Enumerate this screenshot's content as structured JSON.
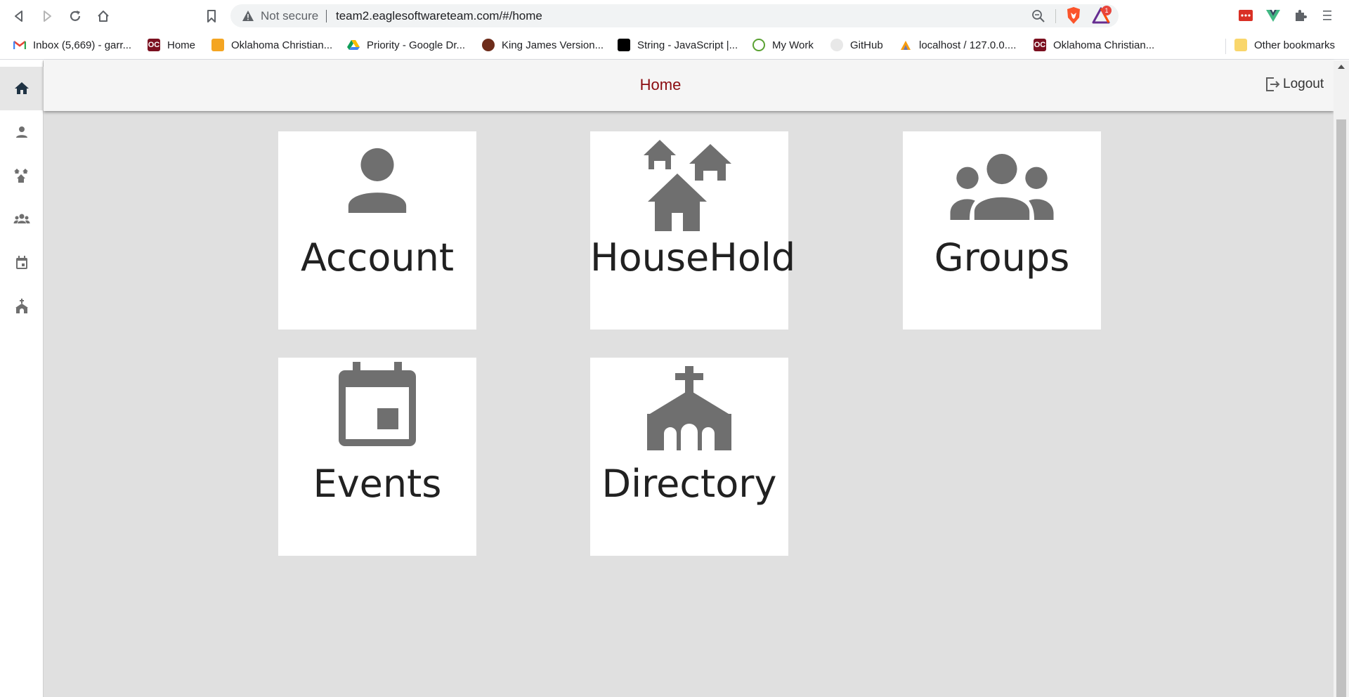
{
  "browser": {
    "security_text": "Not secure",
    "url": "team2.eaglesoftwareteam.com/#/home",
    "bat_badge": "1",
    "bookmarks": [
      {
        "label": "Inbox (5,669) - garr..."
      },
      {
        "label": "Home"
      },
      {
        "label": "Oklahoma Christian..."
      },
      {
        "label": "Priority - Google Dr..."
      },
      {
        "label": "King James Version..."
      },
      {
        "label": "String - JavaScript |..."
      },
      {
        "label": "My Work"
      },
      {
        "label": "GitHub"
      },
      {
        "label": "localhost / 127.0.0...."
      },
      {
        "label": "Oklahoma Christian..."
      }
    ],
    "other_bookmarks": "Other bookmarks"
  },
  "header": {
    "title": "Home",
    "logout_label": "Logout"
  },
  "sidenav": {
    "items": [
      {
        "icon": "home-icon",
        "active": true
      },
      {
        "icon": "person-icon"
      },
      {
        "icon": "household-icon"
      },
      {
        "icon": "groups-icon"
      },
      {
        "icon": "calendar-icon"
      },
      {
        "icon": "church-icon"
      }
    ]
  },
  "tiles": [
    {
      "label": "Account",
      "icon": "person-icon"
    },
    {
      "label": "HouseHold",
      "icon": "household-icon"
    },
    {
      "label": "Groups",
      "icon": "groups-icon"
    },
    {
      "label": "Events",
      "icon": "calendar-icon"
    },
    {
      "label": "Directory",
      "icon": "church-icon"
    }
  ],
  "colors": {
    "accent_title": "#8b0c10",
    "icon_gray": "#6f6f6f",
    "page_background": "#e0e0e0"
  }
}
